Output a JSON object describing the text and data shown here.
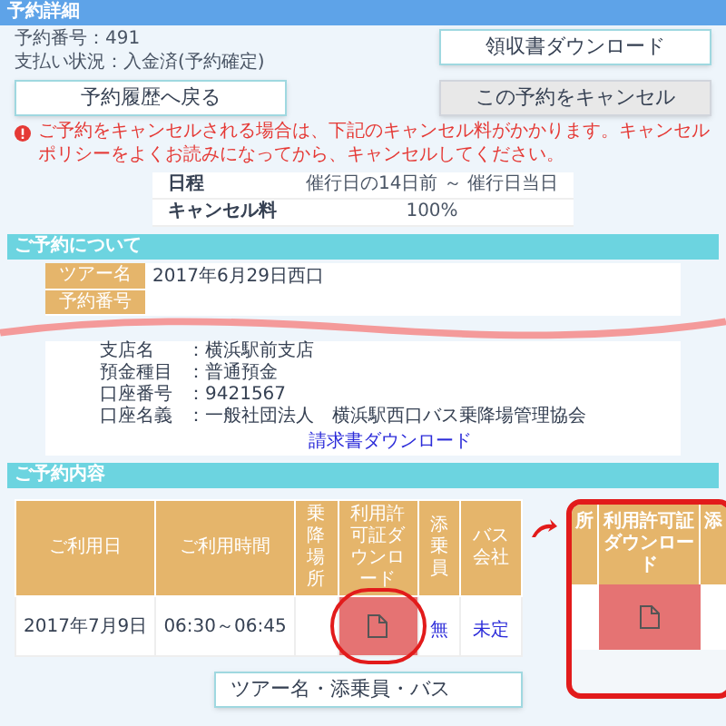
{
  "header": {
    "title": "予約詳細"
  },
  "booking_info": [
    "予約番号：491",
    "支払い状況：入金済(予約確定)"
  ],
  "receipt_button": {
    "label": "領収書ダウンロード"
  },
  "back_button": {
    "label": "予約履歴へ戻る"
  },
  "cancel_button": {
    "label": "この予約をキャンセル"
  },
  "warning": "ご予約をキャンセルされる場合は、下記のキャンセル料がかかります。キャンセルポリシーをよくお読みになってから、キャンセルしてください。",
  "cancel_policy": [
    {
      "label": "日程",
      "value": "催行日の14日前 ～ 催行日当日"
    },
    {
      "label": "キャンセル料",
      "value": "100%"
    }
  ],
  "about": {
    "title": "ご予約について",
    "rows": [
      {
        "label": "ツアー名",
        "value": "2017年6月29日西口"
      },
      {
        "label": "予約番号"
      }
    ],
    "bank_rows": [
      {
        "label": "支店名",
        "value": "：横浜駅前支店"
      },
      {
        "label": "預金種目",
        "value": "：普通預金"
      },
      {
        "label": "口座番号",
        "value": "：9421567"
      },
      {
        "label": "口座名義",
        "value": "：一般社団法人　横浜駅西口バス乗降場管理協会"
      }
    ],
    "link": "請求書ダウンロード"
  },
  "contents": {
    "title": "ご予約内容",
    "columns": [
      "ご利用日",
      "ご利用時間",
      "乗降場所",
      "利用許可証ダウンロード",
      "添乗員",
      "バス会社"
    ],
    "rows": [
      {
        "cells": [
          {
            "kind": "text",
            "text": "2017年7月9日"
          },
          {
            "kind": "text",
            "text": "06:30～06:45"
          },
          {
            "kind": "empty"
          },
          {
            "kind": "file",
            "highlighted": true
          },
          {
            "kind": "link",
            "text": "無"
          },
          {
            "kind": "link",
            "text": "未定"
          }
        ]
      }
    ]
  },
  "edit_button": {
    "label": "ツアー名・添乗員・バス"
  },
  "callout": {
    "columns": [
      "所",
      "利用許可証ダウンロード",
      "添"
    ]
  }
}
